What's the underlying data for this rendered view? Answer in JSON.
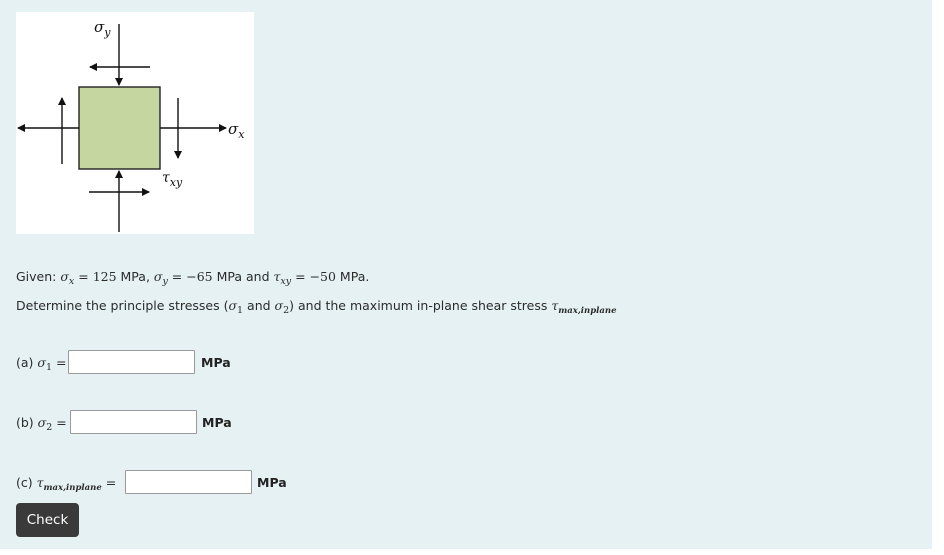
{
  "figure": {
    "sigma_y_label": "σ",
    "sigma_y_sub": "y",
    "sigma_x_label": "σ",
    "sigma_x_sub": "x",
    "tau_label": "τ",
    "tau_sub": "xy",
    "element_color": "#c5d6a1"
  },
  "given": {
    "prefix": "Given: ",
    "sx_sym": "σ",
    "sx_sub": "x",
    "sx_eq": " = ",
    "sx_val": "125",
    "sx_unit": " MPa, ",
    "sy_sym": "σ",
    "sy_sub": "y",
    "sy_eq": " = ",
    "sy_val": "−65",
    "sy_unit": " MPa and ",
    "txy_sym": "τ",
    "txy_sub": "xy",
    "txy_eq": " = ",
    "txy_val": "−50",
    "txy_unit": " MPa."
  },
  "question": {
    "text_a": "Determine the principle stresses (",
    "s1_sym": "σ",
    "s1_sub": "1",
    "text_b": " and ",
    "s2_sym": "σ",
    "s2_sub": "2",
    "text_c": ") and the maximum in-plane shear stress ",
    "tau_sym": "τ",
    "tau_sub": "max,inplane"
  },
  "answers": [
    {
      "prefix": "(a) ",
      "sym": "σ",
      "sub": "1",
      "eq": " =",
      "value": "",
      "unit": "MPa"
    },
    {
      "prefix": "(b) ",
      "sym": "σ",
      "sub": "2",
      "eq": " =",
      "value": "",
      "unit": "MPa"
    },
    {
      "prefix": "(c) ",
      "sym": "τ",
      "sub": "max,inplane",
      "eq": " =",
      "value": "",
      "unit": "MPa"
    }
  ],
  "check_label": "Check"
}
